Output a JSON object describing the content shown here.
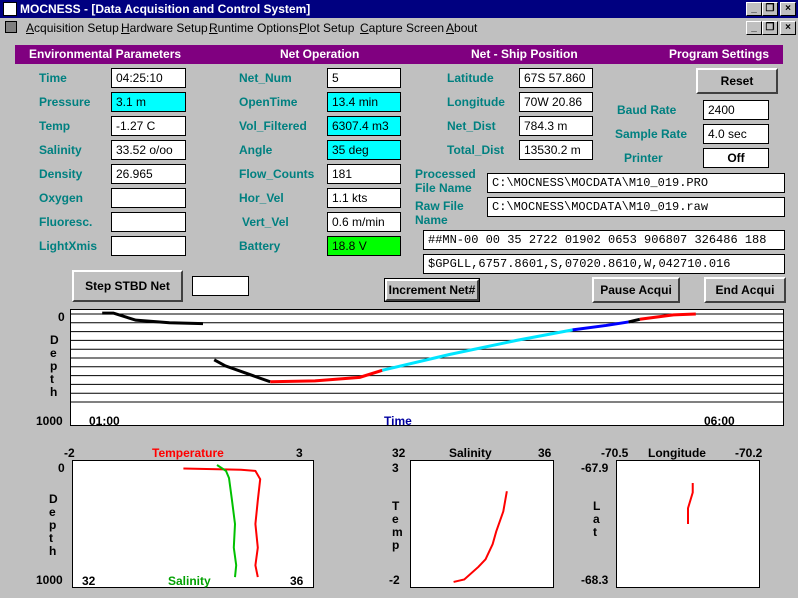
{
  "window": {
    "title": "MOCNESS - [Data Acquisition and Control System]"
  },
  "menu": {
    "items": [
      "Acquisition Setup",
      "Hardware Setup",
      "Runtime Options",
      "Plot Setup",
      "Capture Screen",
      "About"
    ]
  },
  "sections": {
    "env": "Environmental Parameters",
    "net": "Net Operation",
    "pos": "Net - Ship Position",
    "prog": "Program Settings"
  },
  "env": {
    "time_label": "Time",
    "time": "04:25:10",
    "pressure_label": "Pressure",
    "pressure": "3.1 m",
    "temp_label": "Temp",
    "temp": "-1.27 C",
    "salinity_label": "Salinity",
    "salinity": "33.52 o/oo",
    "density_label": "Density",
    "density": "26.965",
    "oxygen_label": "Oxygen",
    "oxygen": "",
    "fluoresc_label": "Fluoresc.",
    "fluoresc": "",
    "lightxmis_label": "LightXmis",
    "lightxmis": ""
  },
  "net": {
    "net_num_label": "Net_Num",
    "net_num": "5",
    "opentime_label": "OpenTime",
    "opentime": "13.4 min",
    "vol_label": "Vol_Filtered",
    "vol": "6307.4 m3",
    "angle_label": "Angle",
    "angle": "35 deg",
    "flow_label": "Flow_Counts",
    "flow": "181",
    "hor_label": "Hor_Vel",
    "hor": "1.1 kts",
    "vert_label": "Vert_Vel",
    "vert": "0.6 m/min",
    "battery_label": "Battery",
    "battery": "18.8 V"
  },
  "pos": {
    "lat_label": "Latitude",
    "lat": "67S 57.860",
    "lon_label": "Longitude",
    "lon": "70W 20.86",
    "netdist_label": "Net_Dist",
    "netdist": "784.3 m",
    "totdist_label": "Total_Dist",
    "totdist": "13530.2 m"
  },
  "prog": {
    "reset": "Reset",
    "baud_label": "Baud Rate",
    "baud": "2400",
    "sample_label": "Sample Rate",
    "sample": "4.0 sec",
    "printer_label": "Printer",
    "printer": "Off"
  },
  "files": {
    "processed_label_1": "Processed",
    "processed_label_2": "File Name",
    "processed": "C:\\MOCNESS\\MOCDATA\\M10_019.PRO",
    "raw_label_1": "Raw File",
    "raw_label_2": "Name",
    "raw": "C:\\MOCNESS\\MOCDATA\\M10_019.raw",
    "data_line_1": "##MN-00 00 35 2722 01902 0653 906807 326486 188",
    "data_line_2": "$GPGLL,6757.8601,S,07020.8610,W,042710.016"
  },
  "buttons": {
    "step": "Step STBD Net",
    "step_value": "",
    "increment": "Increment Net#",
    "pause": "Pause Acqui",
    "end": "End Acqui"
  },
  "colors": {
    "section_bar": "#800080",
    "label_teal": "#008080",
    "cyan": "#00ffff",
    "green": "#00ff00",
    "title_bar": "#000080"
  },
  "depth_chart": {
    "y_top": "0",
    "y_bottom": "1000",
    "y_label": "Depth",
    "x_start": "01:00",
    "x_end": "06:00",
    "x_label": "Time"
  },
  "ts_chart": {
    "temp_min": "-2",
    "temp_max": "3",
    "temp_label": "Temperature",
    "sal_min": "32",
    "sal_max": "36",
    "sal_label": "Salinity",
    "y_top": "0",
    "y_bottom": "1000",
    "y_label": "Depth"
  },
  "tsal_chart": {
    "x_min": "32",
    "x_max": "36",
    "title": "Salinity",
    "y_top": "3",
    "y_bottom": "-2",
    "y_label": "Temp"
  },
  "pos_chart": {
    "x_min": "-70.5",
    "x_max": "-70.2",
    "title": "Longitude",
    "y_top": "-67.9",
    "y_bottom": "-68.3",
    "y_label": "Lat"
  },
  "chart_data": [
    {
      "type": "line",
      "title": "",
      "xlabel": "Time",
      "ylabel": "Depth",
      "x_range": [
        "01:00",
        "06:00"
      ],
      "ylim": [
        1000,
        0
      ],
      "series": [
        {
          "color": "#000000",
          "x": [
            "01:05",
            "01:10",
            "01:20",
            "01:35",
            "01:50"
          ],
          "y": [
            -10,
            -10,
            70,
            100,
            110
          ]
        },
        {
          "color": "#000000",
          "x": [
            "01:55",
            "02:00",
            "02:10",
            "02:20"
          ],
          "y": [
            520,
            590,
            680,
            770
          ]
        },
        {
          "color": "#ff0000",
          "x": [
            "02:20",
            "02:40",
            "03:00",
            "03:10"
          ],
          "y": [
            770,
            760,
            720,
            640
          ]
        },
        {
          "color": "#00e5ff",
          "x": [
            "03:10",
            "03:40",
            "04:10",
            "04:35"
          ],
          "y": [
            640,
            460,
            300,
            180
          ]
        },
        {
          "color": "#0000ff",
          "x": [
            "04:35",
            "04:50",
            "05:00"
          ],
          "y": [
            180,
            130,
            90
          ]
        },
        {
          "color": "#000000",
          "x": [
            "05:00",
            "05:05"
          ],
          "y": [
            90,
            60
          ]
        },
        {
          "color": "#ff0000",
          "x": [
            "05:05",
            "05:20",
            "05:30"
          ],
          "y": [
            60,
            10,
            0
          ]
        }
      ]
    },
    {
      "type": "line",
      "title": "",
      "xlabel": "Temperature / Salinity",
      "ylabel": "Depth",
      "ylim": [
        1000,
        0
      ],
      "series": [
        {
          "name": "Temperature",
          "color": "#ff0000",
          "temp": [
            0.3,
            1.5,
            1.8,
            1.9,
            1.85,
            1.8,
            1.85,
            1.8,
            1.85
          ],
          "depth": [
            30,
            40,
            50,
            120,
            300,
            500,
            700,
            850,
            950
          ]
        },
        {
          "name": "Salinity",
          "color": "#00c000",
          "salinity": [
            34.4,
            34.55,
            34.6,
            34.65,
            34.7,
            34.68,
            34.72,
            34.7
          ],
          "depth": [
            0,
            50,
            110,
            300,
            500,
            700,
            850,
            950
          ]
        }
      ]
    },
    {
      "type": "scatter",
      "title": "Salinity",
      "xlabel": "Salinity",
      "ylabel": "Temp",
      "xlim": [
        32,
        36
      ],
      "ylim": [
        -2,
        3
      ],
      "series": [
        {
          "color": "#ff0000",
          "salinity": [
            33.2,
            33.5,
            33.9,
            34.1,
            34.3,
            34.4,
            34.6,
            34.7
          ],
          "temp": [
            -1.8,
            -1.7,
            -1.2,
            -0.9,
            -0.3,
            0.2,
            1.0,
            1.8
          ]
        }
      ]
    },
    {
      "type": "line",
      "title": "Longitude",
      "xlabel": "Longitude",
      "ylabel": "Lat",
      "xlim": [
        -70.5,
        -70.2
      ],
      "ylim": [
        -68.3,
        -67.9
      ],
      "series": [
        {
          "color": "#ff0000",
          "lon": [
            -70.35,
            -70.35,
            -70.34,
            -70.34
          ],
          "lat": [
            -68.1,
            -68.05,
            -68.0,
            -67.97
          ]
        }
      ]
    }
  ]
}
